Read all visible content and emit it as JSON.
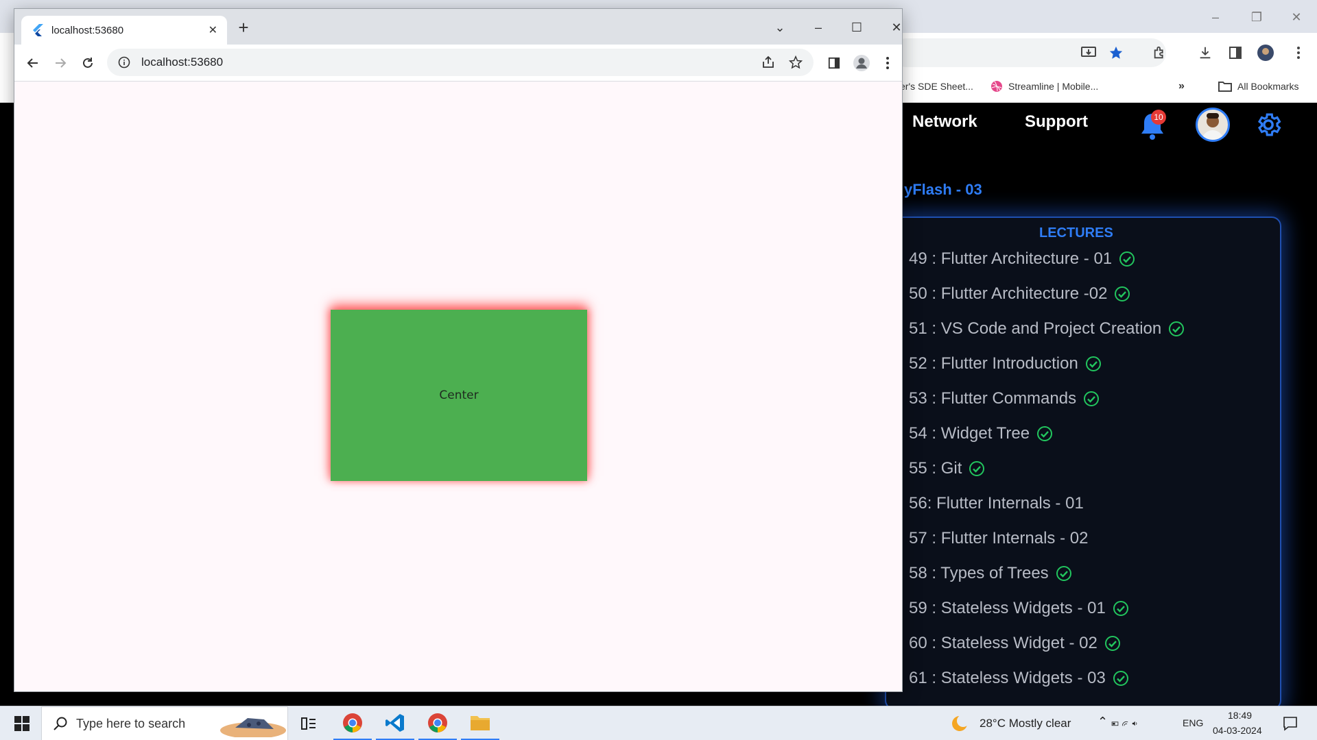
{
  "background_window": {
    "bookmarks": [
      "er's SDE Sheet...",
      "Streamline | Mobile...",
      "All Bookmarks"
    ],
    "site_nav": [
      "Network",
      "Support"
    ],
    "notification_count": "10",
    "course_title": "yFlash - 03",
    "lectures_heading": "LECTURES",
    "lectures": [
      {
        "label": "49 : Flutter Architecture - 01",
        "done": true
      },
      {
        "label": "50 : Flutter Architecture -02",
        "done": true
      },
      {
        "label": "51 : VS Code and Project Creation",
        "done": true
      },
      {
        "label": "52 : Flutter Introduction",
        "done": true
      },
      {
        "label": "53 : Flutter Commands",
        "done": true
      },
      {
        "label": "54 : Widget Tree",
        "done": true
      },
      {
        "label": "55 : Git",
        "done": true
      },
      {
        "label": "56: Flutter Internals - 01",
        "done": false
      },
      {
        "label": "57 : Flutter Internals - 02",
        "done": false
      },
      {
        "label": "58 : Types of Trees",
        "done": true
      },
      {
        "label": "59 : Stateless Widgets - 01",
        "done": true
      },
      {
        "label": "60 : Stateless Widget - 02",
        "done": true
      },
      {
        "label": "61 : Stateless Widgets - 03",
        "done": true
      }
    ]
  },
  "foreground_window": {
    "tab_title": "localhost:53680",
    "url": "localhost:53680",
    "box_label": "Center",
    "box_color": "#4caf50"
  },
  "taskbar": {
    "search_placeholder": "Type here to search",
    "weather": "28°C  Mostly clear",
    "language": "ENG",
    "time": "18:49",
    "date": "04-03-2024"
  },
  "colors": {
    "accent": "#2f7df6",
    "check": "#22c55e"
  }
}
